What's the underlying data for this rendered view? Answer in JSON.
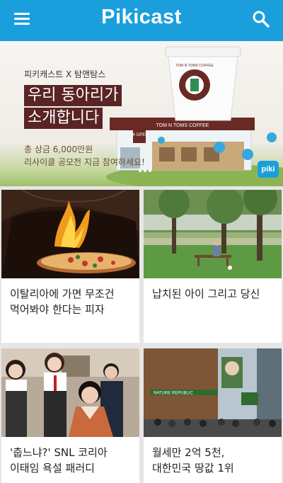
{
  "app": {
    "logo": "Pikicast",
    "brand_color": "#1b9fdc"
  },
  "header": {
    "menu_icon": "hamburger-menu-icon",
    "search_icon": "search-icon"
  },
  "banner": {
    "subtitle": "피키캐스트 X 탐앤탐스",
    "headline_line1": "우리 동아리가",
    "headline_line2": "소개합니다",
    "prize": "총 상금 6,000만원",
    "cta": "리사이클 공모전 지금 참여하세요!",
    "cup_logo": "TOM N TOMS COFFEE",
    "booth_sign": "TOM N TOMS COFFEE",
    "booth_small_sign": "24 OPEN",
    "badge": "piki"
  },
  "feed": [
    {
      "title_line1": "이탈리아에 가면 무조건",
      "title_line2": "먹어봐야 한다는 피자"
    },
    {
      "title_line1": "납치된 아이 그리고 당신",
      "title_line2": ""
    },
    {
      "title_line1": "'춥느냐?' SNL 코리아",
      "title_line2": "이태임 욕설 패러디"
    },
    {
      "title_line1": "월세만 2억 5천,",
      "title_line2": "대한민국 땅값 1위",
      "store_sign": "NATURE REPUBLIC"
    }
  ]
}
